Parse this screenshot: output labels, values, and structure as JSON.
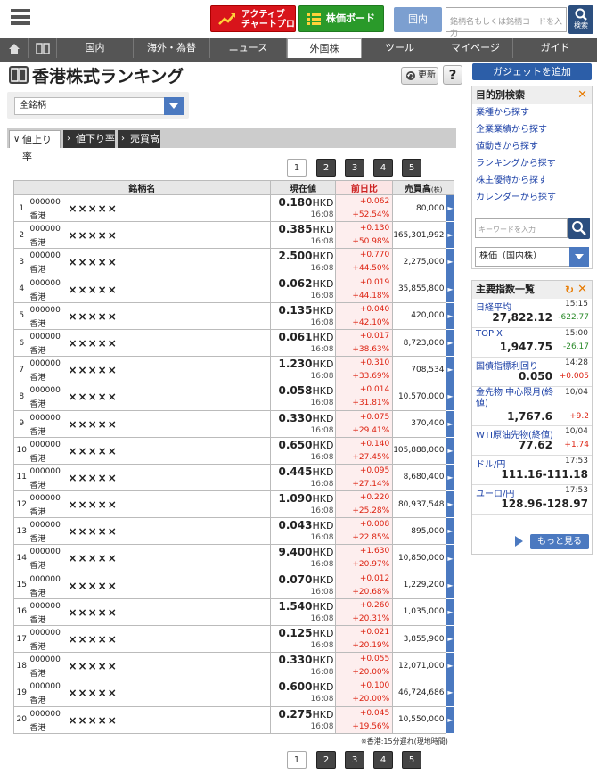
{
  "header": {
    "active_chart_line1": "アクティブ",
    "active_chart_line2": "チャートプロ",
    "board": "株価ボード",
    "domestic": "国内",
    "search_placeholder": "銘柄名もしくは銘柄コードを入力",
    "search_btn": "検索"
  },
  "nav": {
    "items": [
      "国内",
      "海外・為替",
      "ニュース",
      "外国株",
      "ツール",
      "マイページ",
      "ガイド"
    ],
    "active": "外国株"
  },
  "page": {
    "title": "香港株式ランキング",
    "refresh": "更新",
    "help": "?",
    "filter": "全銘柄"
  },
  "tabs": [
    "値上り率",
    "値下り率",
    "売買高"
  ],
  "pager": [
    "1",
    "2",
    "3",
    "4",
    "5"
  ],
  "table": {
    "headers": {
      "name": "銘柄名",
      "price": "現在値",
      "change": "前日比",
      "volume": "売買高",
      "volume_unit": "(株)"
    },
    "currency": "HKD",
    "rows": [
      {
        "rank": "1",
        "code": "000000",
        "market": "香港",
        "name": "×××××",
        "price": "0.180",
        "time": "16:08",
        "chg": "+0.062",
        "pct": "+52.54%",
        "vol": "80,000"
      },
      {
        "rank": "2",
        "code": "000000",
        "market": "香港",
        "name": "×××××",
        "price": "0.385",
        "time": "16:08",
        "chg": "+0.130",
        "pct": "+50.98%",
        "vol": "165,301,992"
      },
      {
        "rank": "3",
        "code": "000000",
        "market": "香港",
        "name": "×××××",
        "price": "2.500",
        "time": "16:08",
        "chg": "+0.770",
        "pct": "+44.50%",
        "vol": "2,275,000"
      },
      {
        "rank": "4",
        "code": "000000",
        "market": "香港",
        "name": "×××××",
        "price": "0.062",
        "time": "16:08",
        "chg": "+0.019",
        "pct": "+44.18%",
        "vol": "35,855,800"
      },
      {
        "rank": "5",
        "code": "000000",
        "market": "香港",
        "name": "×××××",
        "price": "0.135",
        "time": "16:08",
        "chg": "+0.040",
        "pct": "+42.10%",
        "vol": "420,000"
      },
      {
        "rank": "6",
        "code": "000000",
        "market": "香港",
        "name": "×××××",
        "price": "0.061",
        "time": "16:08",
        "chg": "+0.017",
        "pct": "+38.63%",
        "vol": "8,723,000"
      },
      {
        "rank": "7",
        "code": "000000",
        "market": "香港",
        "name": "×××××",
        "price": "1.230",
        "time": "16:08",
        "chg": "+0.310",
        "pct": "+33.69%",
        "vol": "708,534"
      },
      {
        "rank": "8",
        "code": "000000",
        "market": "香港",
        "name": "×××××",
        "price": "0.058",
        "time": "16:08",
        "chg": "+0.014",
        "pct": "+31.81%",
        "vol": "10,570,000"
      },
      {
        "rank": "9",
        "code": "000000",
        "market": "香港",
        "name": "×××××",
        "price": "0.330",
        "time": "16:08",
        "chg": "+0.075",
        "pct": "+29.41%",
        "vol": "370,400"
      },
      {
        "rank": "10",
        "code": "000000",
        "market": "香港",
        "name": "×××××",
        "price": "0.650",
        "time": "16:08",
        "chg": "+0.140",
        "pct": "+27.45%",
        "vol": "105,888,000"
      },
      {
        "rank": "11",
        "code": "000000",
        "market": "香港",
        "name": "×××××",
        "price": "0.445",
        "time": "16:08",
        "chg": "+0.095",
        "pct": "+27.14%",
        "vol": "8,680,400"
      },
      {
        "rank": "12",
        "code": "000000",
        "market": "香港",
        "name": "×××××",
        "price": "1.090",
        "time": "16:08",
        "chg": "+0.220",
        "pct": "+25.28%",
        "vol": "80,937,548"
      },
      {
        "rank": "13",
        "code": "000000",
        "market": "香港",
        "name": "×××××",
        "price": "0.043",
        "time": "16:08",
        "chg": "+0.008",
        "pct": "+22.85%",
        "vol": "895,000"
      },
      {
        "rank": "14",
        "code": "000000",
        "market": "香港",
        "name": "×××××",
        "price": "9.400",
        "time": "16:08",
        "chg": "+1.630",
        "pct": "+20.97%",
        "vol": "10,850,000"
      },
      {
        "rank": "15",
        "code": "000000",
        "market": "香港",
        "name": "×××××",
        "price": "0.070",
        "time": "16:08",
        "chg": "+0.012",
        "pct": "+20.68%",
        "vol": "1,229,200"
      },
      {
        "rank": "16",
        "code": "000000",
        "market": "香港",
        "name": "×××××",
        "price": "1.540",
        "time": "16:08",
        "chg": "+0.260",
        "pct": "+20.31%",
        "vol": "1,035,000"
      },
      {
        "rank": "17",
        "code": "000000",
        "market": "香港",
        "name": "×××××",
        "price": "0.125",
        "time": "16:08",
        "chg": "+0.021",
        "pct": "+20.19%",
        "vol": "3,855,900"
      },
      {
        "rank": "18",
        "code": "000000",
        "market": "香港",
        "name": "×××××",
        "price": "0.330",
        "time": "16:08",
        "chg": "+0.055",
        "pct": "+20.00%",
        "vol": "12,071,000"
      },
      {
        "rank": "19",
        "code": "000000",
        "market": "香港",
        "name": "×××××",
        "price": "0.600",
        "time": "16:08",
        "chg": "+0.100",
        "pct": "+20.00%",
        "vol": "46,724,686"
      },
      {
        "rank": "20",
        "code": "000000",
        "market": "香港",
        "name": "×××××",
        "price": "0.275",
        "time": "16:08",
        "chg": "+0.045",
        "pct": "+19.56%",
        "vol": "10,550,000"
      }
    ],
    "note": "※香港:15分遅れ(現地時間)"
  },
  "sidebar": {
    "gadget": "ガジェットを追加",
    "purpose": {
      "title": "目的別検索",
      "links": [
        "業種から探す",
        "企業業績から探す",
        "値動きから探す",
        "ランキングから探す",
        "株主優待から探す",
        "カレンダーから探す"
      ],
      "kw_placeholder": "キーワードを入力",
      "select": "株価（国内株）"
    },
    "indices": {
      "title": "主要指数一覧",
      "items": [
        {
          "name": "日経平均",
          "time": "15:15",
          "value": "27,822.12",
          "chg": "-622.77",
          "dir": "down"
        },
        {
          "name": "TOPIX",
          "time": "15:00",
          "value": "1,947.75",
          "chg": "-26.17",
          "dir": "down"
        },
        {
          "name": "国債指標利回り",
          "time": "14:28",
          "value": "0.050",
          "chg": "+0.005",
          "dir": "up"
        },
        {
          "name": "金先物 中心限月(終値)",
          "time": "10/04",
          "value": "1,767.6",
          "chg": "+9.2",
          "dir": "up"
        },
        {
          "name": "WTI原油先物(終値)",
          "time": "10/04",
          "value": "77.62",
          "chg": "+1.74",
          "dir": "up"
        },
        {
          "name": "ドル/円",
          "time": "17:53",
          "value": "111.16-111.18",
          "chg": "",
          "dir": ""
        },
        {
          "name": "ユーロ/円",
          "time": "17:53",
          "value": "128.96-128.97",
          "chg": "",
          "dir": ""
        }
      ],
      "more": "もっと見る"
    }
  }
}
